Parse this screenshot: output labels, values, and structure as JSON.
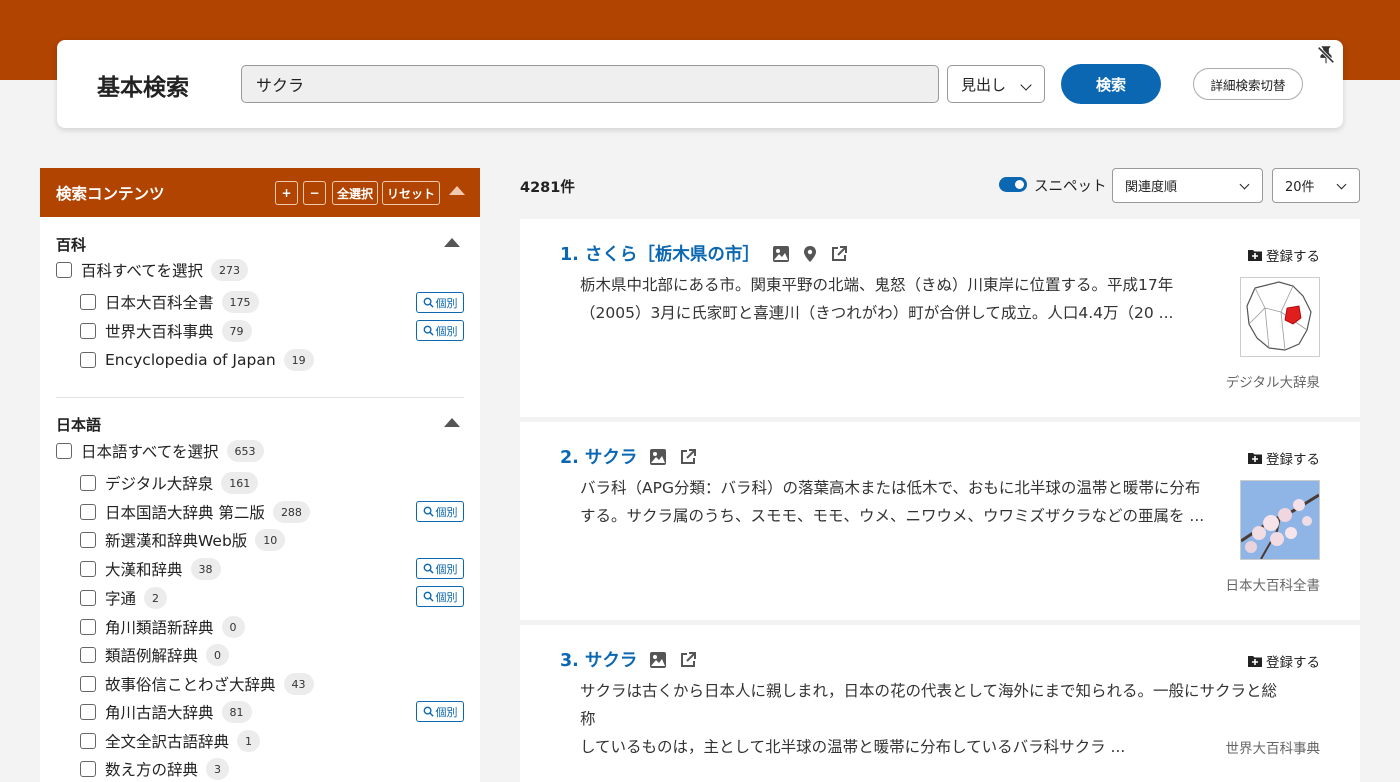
{
  "search": {
    "title": "基本検索",
    "query": "サクラ",
    "field": "見出し",
    "submit_label": "検索",
    "advanced_label": "詳細検索切替"
  },
  "sidebar": {
    "title": "検索コンテンツ",
    "buttons": {
      "plus": "+",
      "minus": "−",
      "select_all": "全選択",
      "reset": "リセット"
    },
    "individual_label": "個別",
    "sections": [
      {
        "title": "百科",
        "select_all": {
          "label": "百科すべてを選択",
          "count": "273"
        },
        "items": [
          {
            "label": "日本大百科全書",
            "count": "175",
            "individual": true
          },
          {
            "label": "世界大百科事典",
            "count": "79",
            "individual": true
          },
          {
            "label": "Encyclopedia of Japan",
            "count": "19",
            "individual": false
          }
        ]
      },
      {
        "title": "日本語",
        "select_all": {
          "label": "日本語すべてを選択",
          "count": "653"
        },
        "items": [
          {
            "label": "デジタル大辞泉",
            "count": "161",
            "individual": false
          },
          {
            "label": "日本国語大辞典 第二版",
            "count": "288",
            "individual": true
          },
          {
            "label": "新選漢和辞典Web版",
            "count": "10",
            "individual": false
          },
          {
            "label": "大漢和辞典",
            "count": "38",
            "individual": true
          },
          {
            "label": "字通",
            "count": "2",
            "individual": true
          },
          {
            "label": "角川類語新辞典",
            "count": "0",
            "individual": false
          },
          {
            "label": "類語例解辞典",
            "count": "0",
            "individual": false
          },
          {
            "label": "故事俗信ことわざ大辞典",
            "count": "43",
            "individual": false
          },
          {
            "label": "角川古語大辞典",
            "count": "81",
            "individual": true
          },
          {
            "label": "全文全訳古語辞典",
            "count": "1",
            "individual": false
          },
          {
            "label": "数え方の辞典",
            "count": "3",
            "individual": false
          }
        ]
      }
    ]
  },
  "results": {
    "count": "4281件",
    "snippet_label": "スニペット",
    "snippet_on": true,
    "sort": "関連度順",
    "per_page": "20件",
    "register_label": "登録する",
    "items": [
      {
        "title": "1. さくら［栃木県の市］",
        "snippet_line1": "栃木県中北部にある市。関東平野の北端、鬼怒（きぬ）川東岸に位置する。平成17年",
        "snippet_line2": "（2005）3月に氏家町と喜連川（きつれがわ）町が合併して成立。人口4.4万（20 ...",
        "source": "デジタル大辞泉",
        "icons": [
          "image-icon",
          "map-pin-icon",
          "external-link-icon"
        ],
        "thumbnail": "map"
      },
      {
        "title": "2. サクラ",
        "snippet_line1": "バラ科（APG分類：バラ科）の落葉高木または低木で、おもに北半球の温帯と暖帯に分布",
        "snippet_line2": "する。サクラ属のうち、スモモ、モモ、ウメ、ニワウメ、ウワミズザクラなどの亜属を ...",
        "source": "日本大百科全書",
        "icons": [
          "image-icon",
          "external-link-icon"
        ],
        "thumbnail": "photo"
      },
      {
        "title": "3. サクラ",
        "snippet_line1": "サクラは古くから日本人に親しまれ，日本の花の代表として海外にまで知られる。一般にサクラと総称",
        "snippet_line2": "しているものは，主として北半球の温帯と暖帯に分布しているバラ科サクラ ...",
        "source": "世界大百科事典",
        "icons": [
          "image-icon",
          "external-link-icon"
        ],
        "thumbnail": ""
      }
    ]
  },
  "colors": {
    "brand": "#b04400",
    "accent": "#0b67b2"
  }
}
